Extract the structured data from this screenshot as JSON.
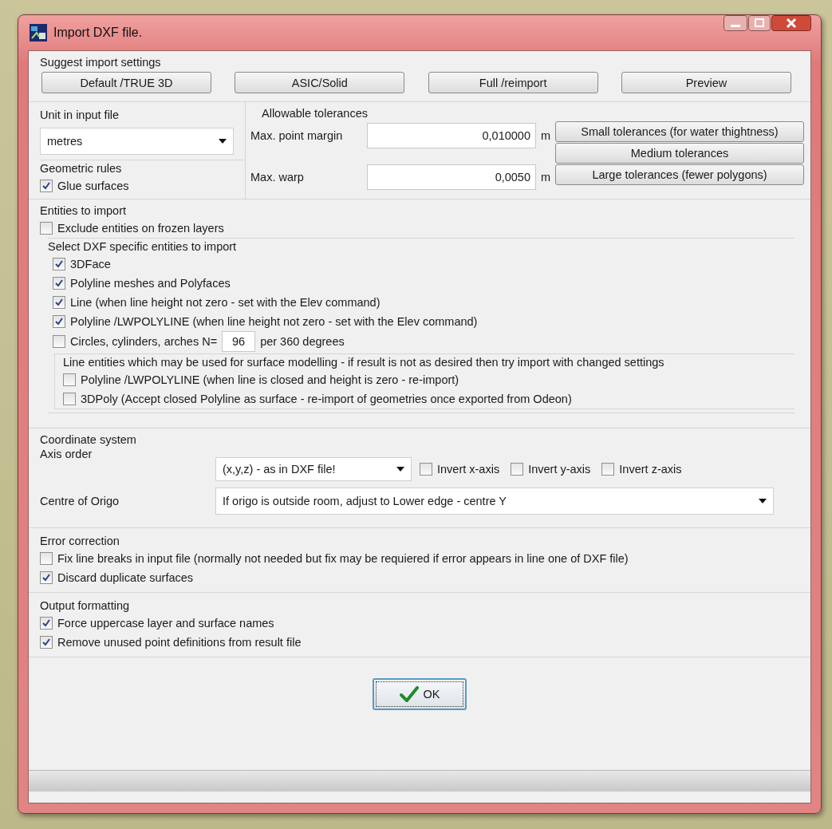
{
  "window": {
    "title": "Import DXF file."
  },
  "suggest": {
    "label": "Suggest import settings",
    "buttons": [
      "Default /TRUE 3D",
      "ASIC/Solid",
      "Full /reimport",
      "Preview"
    ]
  },
  "unit": {
    "label": "Unit in input file",
    "value": "metres"
  },
  "geometric_rules": {
    "label": "Geometric rules",
    "items": [
      {
        "label": "Glue surfaces",
        "checked": true
      }
    ]
  },
  "tolerances": {
    "label": "Allowable tolerances",
    "fields": [
      {
        "label": "Max. point margin",
        "value": "0,010000",
        "unit": "m"
      },
      {
        "label": "Max. warp",
        "value": "0,0050",
        "unit": "m"
      }
    ],
    "buttons": [
      "Small tolerances (for water thightness)",
      "Medium tolerances",
      "Large tolerances (fewer polygons)"
    ]
  },
  "entities": {
    "label": "Entities to import",
    "exclude": {
      "label": "Exclude entities on frozen layers",
      "checked": false
    },
    "specific": {
      "label": "Select DXF specific entities to import",
      "items": [
        {
          "label": "3DFace",
          "checked": true
        },
        {
          "label": "Polyline meshes and Polyfaces",
          "checked": true
        },
        {
          "label": "Line (when line height not zero - set with the Elev command)",
          "checked": true
        },
        {
          "label": "Polyline /LWPOLYLINE (when line height not zero - set with the Elev command)",
          "checked": true
        }
      ],
      "circles": {
        "label": "Circles, cylinders, arches N=",
        "checked": false,
        "value": "96",
        "suffix": "per 360 degrees"
      },
      "line_entities": {
        "label": "Line entities which may be used for surface modelling - if result is not as desired then try import with changed settings",
        "items": [
          {
            "label": "Polyline /LWPOLYLINE (when line is closed and height is zero - re-import)",
            "checked": false
          },
          {
            "label": "3DPoly (Accept closed Polyline as surface - re-import of geometries once exported from Odeon)",
            "checked": false
          }
        ]
      }
    }
  },
  "coordinate_system": {
    "label": "Coordinate system",
    "axis_order": {
      "label": "Axis order",
      "value": "(x,y,z) - as in DXF file!"
    },
    "inverts": [
      {
        "label": "Invert x-axis",
        "checked": false
      },
      {
        "label": "Invert y-axis",
        "checked": false
      },
      {
        "label": "Invert z-axis",
        "checked": false
      }
    ],
    "origin": {
      "label": "Centre of Origo",
      "value": "If origo is outside room, adjust to Lower edge - centre Y"
    }
  },
  "error_correction": {
    "label": "Error correction",
    "items": [
      {
        "label": "Fix line breaks in input file (normally not needed but fix may be requiered if error appears in line one of DXF file)",
        "checked": false
      },
      {
        "label": "Discard duplicate surfaces",
        "checked": true
      }
    ]
  },
  "output_formatting": {
    "label": "Output formatting",
    "items": [
      {
        "label": "Force uppercase layer and surface names",
        "checked": true
      },
      {
        "label": "Remove unused point definitions from result file",
        "checked": true
      }
    ]
  },
  "ok_button": "OK"
}
